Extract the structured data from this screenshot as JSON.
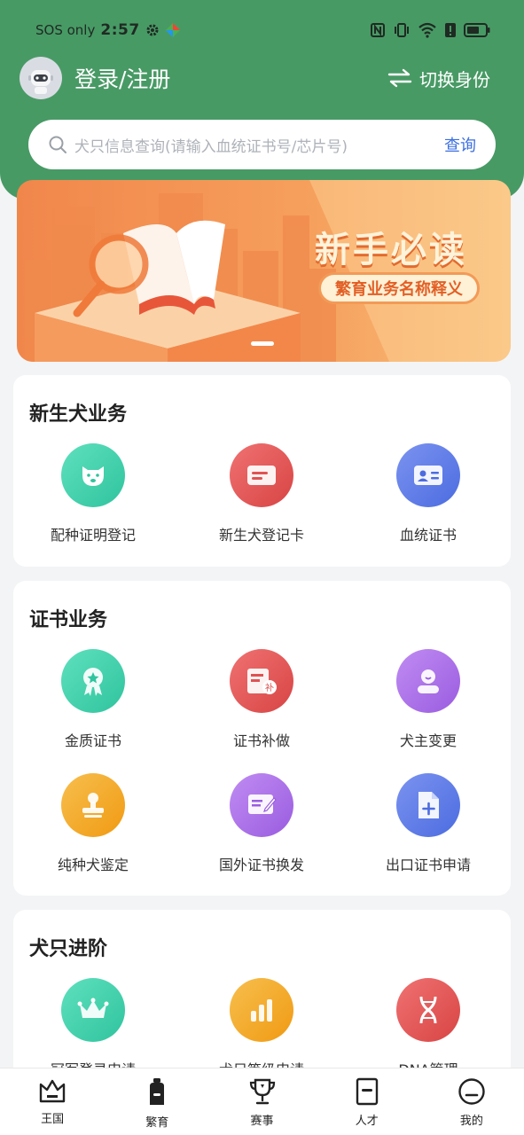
{
  "status_bar": {
    "carrier": "SOS only",
    "time": "2:57",
    "icons": [
      "gear-icon",
      "app-icon",
      "nfc-icon",
      "vibrate-icon",
      "wifi-icon",
      "alert-icon",
      "battery-icon"
    ]
  },
  "header": {
    "login_label": "登录/注册",
    "switch_label": "切换身份",
    "bg_color": "#489a65"
  },
  "search": {
    "placeholder": "犬只信息查询(请输入血统证书号/芯片号)",
    "button_label": "查询"
  },
  "banner": {
    "title": "新手必读",
    "subtitle": "繁育业务名称释义"
  },
  "sections": [
    {
      "title": "新生犬业务",
      "items": [
        {
          "label": "配种证明登记",
          "icon": "dog-icon",
          "color": "#3ecfa9"
        },
        {
          "label": "新生犬登记卡",
          "icon": "card-icon",
          "color": "#e05252"
        },
        {
          "label": "血统证书",
          "icon": "id-card-icon",
          "color": "#4c6ce0"
        }
      ]
    },
    {
      "title": "证书业务",
      "items": [
        {
          "label": "金质证书",
          "icon": "medal-icon",
          "color": "#3ecfa9"
        },
        {
          "label": "证书补做",
          "icon": "reissue-icon",
          "color": "#e05252"
        },
        {
          "label": "犬主变更",
          "icon": "owner-icon",
          "color": "#a766e6"
        },
        {
          "label": "纯种犬鉴定",
          "icon": "stamp-icon",
          "color": "#f2a01e"
        },
        {
          "label": "国外证书换发",
          "icon": "edit-doc-icon",
          "color": "#a766e6"
        },
        {
          "label": "出口证书申请",
          "icon": "add-file-icon",
          "color": "#4c6ce0"
        }
      ]
    },
    {
      "title": "犬只进阶",
      "items": [
        {
          "label": "冠军登录申请",
          "icon": "crown-icon",
          "color": "#3ecfa9"
        },
        {
          "label": "犬只等级申请",
          "icon": "bar-chart-icon",
          "color": "#f2a01e"
        },
        {
          "label": "DNA管理",
          "icon": "dna-icon",
          "color": "#e05252"
        }
      ]
    }
  ],
  "bottom_nav": [
    {
      "label": "王国",
      "icon": "castle-icon"
    },
    {
      "label": "繁育",
      "icon": "bottle-icon",
      "active": true
    },
    {
      "label": "赛事",
      "icon": "trophy-icon"
    },
    {
      "label": "人才",
      "icon": "badge-icon"
    },
    {
      "label": "我的",
      "icon": "face-icon"
    }
  ]
}
